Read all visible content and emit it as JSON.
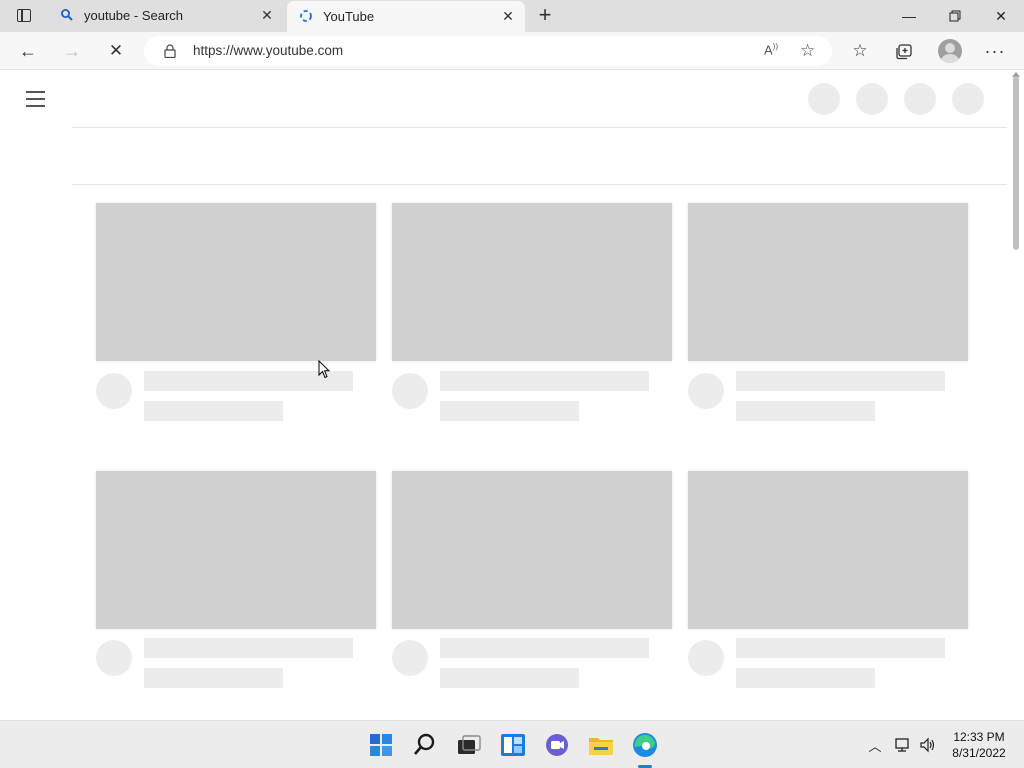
{
  "browser": {
    "tabs": [
      {
        "title": "youtube - Search",
        "favicon": "search-icon",
        "active": false
      },
      {
        "title": "YouTube",
        "favicon": "loading-spinner-icon",
        "active": true
      }
    ],
    "new_tab_icon": "plus-icon",
    "address_bar": {
      "url": "https://www.youtube.com"
    },
    "toolbar_icons": [
      "back-arrow-icon",
      "forward-arrow-icon",
      "stop-icon",
      "lock-icon",
      "read-aloud-icon",
      "add-favorite-icon",
      "favorites-icon",
      "collections-icon",
      "profile-icon",
      "more-icon"
    ],
    "window_controls": [
      "minimize-icon",
      "restore-icon",
      "close-icon"
    ]
  },
  "page": {
    "state": "loading skeleton",
    "masthead_placeholders": 4,
    "video_placeholders": 6
  },
  "taskbar": {
    "apps": [
      "start-icon",
      "search-icon",
      "task-view-icon",
      "widgets-icon",
      "chat-icon",
      "file-explorer-icon",
      "edge-icon"
    ],
    "tray_icons": [
      "chevron-up-icon",
      "network-icon",
      "volume-icon"
    ],
    "time": "12:33 PM",
    "date": "8/31/2022"
  },
  "colors": {
    "skeleton_thumb": "#d0d0d0",
    "skeleton_line": "#ececec",
    "edge_accent": "#2a7ad3"
  }
}
